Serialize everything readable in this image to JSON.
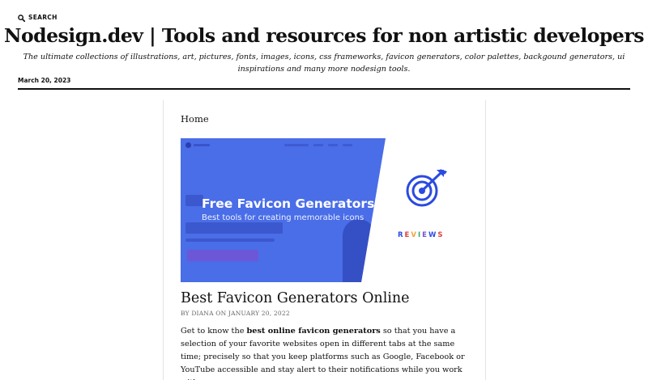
{
  "header": {
    "search_label": "SEARCH",
    "site_title": "Nodesign.dev | Tools and resources for non artistic developers",
    "tagline": "The ultimate collections of illustrations, art, pictures, fonts, images, icons, css frameworks, favicon generators, color palettes, backgound generators, ui inspirations and many more nodesign tools.",
    "date": "March 20, 2023"
  },
  "main": {
    "breadcrumb": "Home",
    "featured_image": {
      "title": "Free Favicon Generators",
      "subtitle": "Best tools for creating memorable icons",
      "badge": "REVIEWS",
      "badge_colors": [
        "#2b4ae0",
        "#e0413a",
        "#f2a33a",
        "#3aa86b",
        "#7a4fd0",
        "#2b4ae0",
        "#e0413a"
      ],
      "accent": "#4a6de8",
      "icon": "target-icon"
    },
    "post": {
      "title": "Best Favicon Generators Online",
      "byline": "BY DIANA ON JANUARY 20, 2022",
      "excerpt_before": "Get to know the ",
      "excerpt_bold": "best online favicon generators",
      "excerpt_after": " so that you have a selection of your favorite websites open in different tabs at the same time; precisely so that you keep platforms such as Google, Facebook or YouTube accessible and stay alert to their notifications while you work with your"
    }
  }
}
